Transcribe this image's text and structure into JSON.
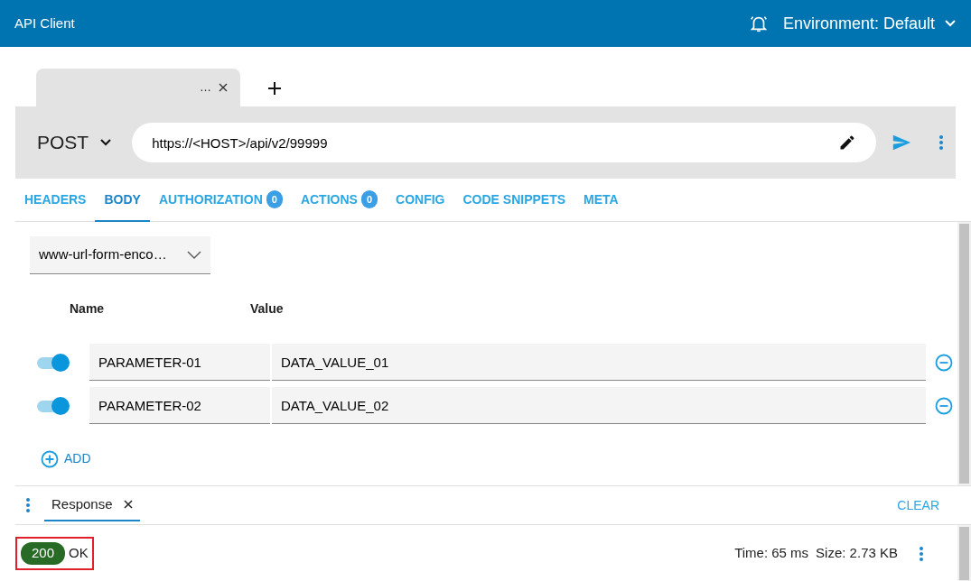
{
  "app_bar": {
    "title": "API Client",
    "environment": "Environment: Default"
  },
  "request_tabs": [
    {
      "label": "…",
      "selected": true
    }
  ],
  "request": {
    "method": "POST",
    "url": "https://<HOST>/api/v2/99999"
  },
  "tabs": [
    {
      "label": "HEADERS",
      "selected": false
    },
    {
      "label": "BODY",
      "selected": true
    },
    {
      "label": "AUTHORIZATION",
      "count": "0",
      "selected": false
    },
    {
      "label": "ACTIONS",
      "count": "0",
      "selected": false
    },
    {
      "label": "CONFIG",
      "selected": false
    },
    {
      "label": "CODE SNIPPETS",
      "selected": false
    },
    {
      "label": "META",
      "selected": false
    }
  ],
  "body": {
    "content_type": "www-url-form-enco…",
    "columns": [
      "Name",
      "Value"
    ],
    "params": [
      {
        "name": "PARAMETER-01",
        "value": "DATA_VALUE_01",
        "on": true
      },
      {
        "name": "PARAMETER-02",
        "value": "DATA_VALUE_02",
        "on": true
      }
    ],
    "add_label": "ADD"
  },
  "response_tabs": [
    {
      "label": "Response",
      "selected": true
    }
  ],
  "clear_label": "CLEAR",
  "status": {
    "code": "200",
    "text": "OK",
    "highlighted": true,
    "time": "Time: 65 ms",
    "size": "Size: 2.73 KB"
  }
}
